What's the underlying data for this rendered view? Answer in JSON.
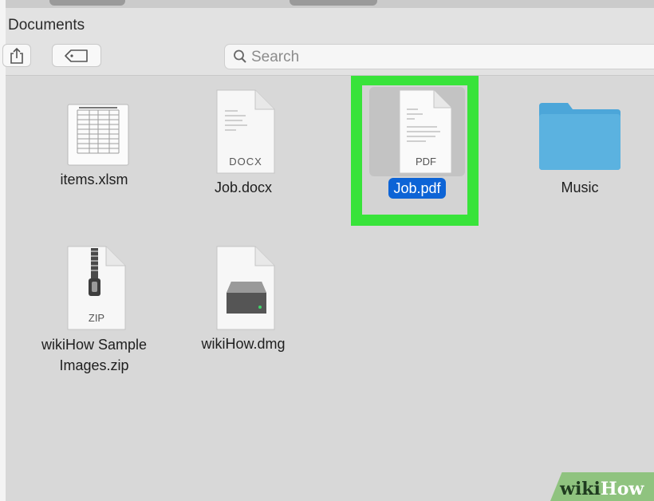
{
  "window": {
    "title": "Documents"
  },
  "toolbar": {
    "share_icon": "share-icon",
    "tag_icon": "tag-icon",
    "search": {
      "icon": "search-icon",
      "placeholder": "Search"
    }
  },
  "files": [
    {
      "name": "items.xlsm",
      "kind": "spreadsheet",
      "badge": ""
    },
    {
      "name": "Job.docx",
      "kind": "document",
      "badge": "DOCX"
    },
    {
      "name": "Job.pdf",
      "kind": "document",
      "badge": "PDF",
      "selected": true
    },
    {
      "name": "Music",
      "kind": "folder",
      "badge": ""
    },
    {
      "name_line1": "wikiHow Sample",
      "name_line2": "Images.zip",
      "kind": "archive",
      "badge": "ZIP"
    },
    {
      "name": "wikiHow.dmg",
      "kind": "disk-image",
      "badge": ""
    }
  ],
  "highlight": {
    "color": "#38e33a"
  },
  "selection_color": "#0d64d6",
  "watermark": {
    "part1": "wiki",
    "part2": "How"
  }
}
